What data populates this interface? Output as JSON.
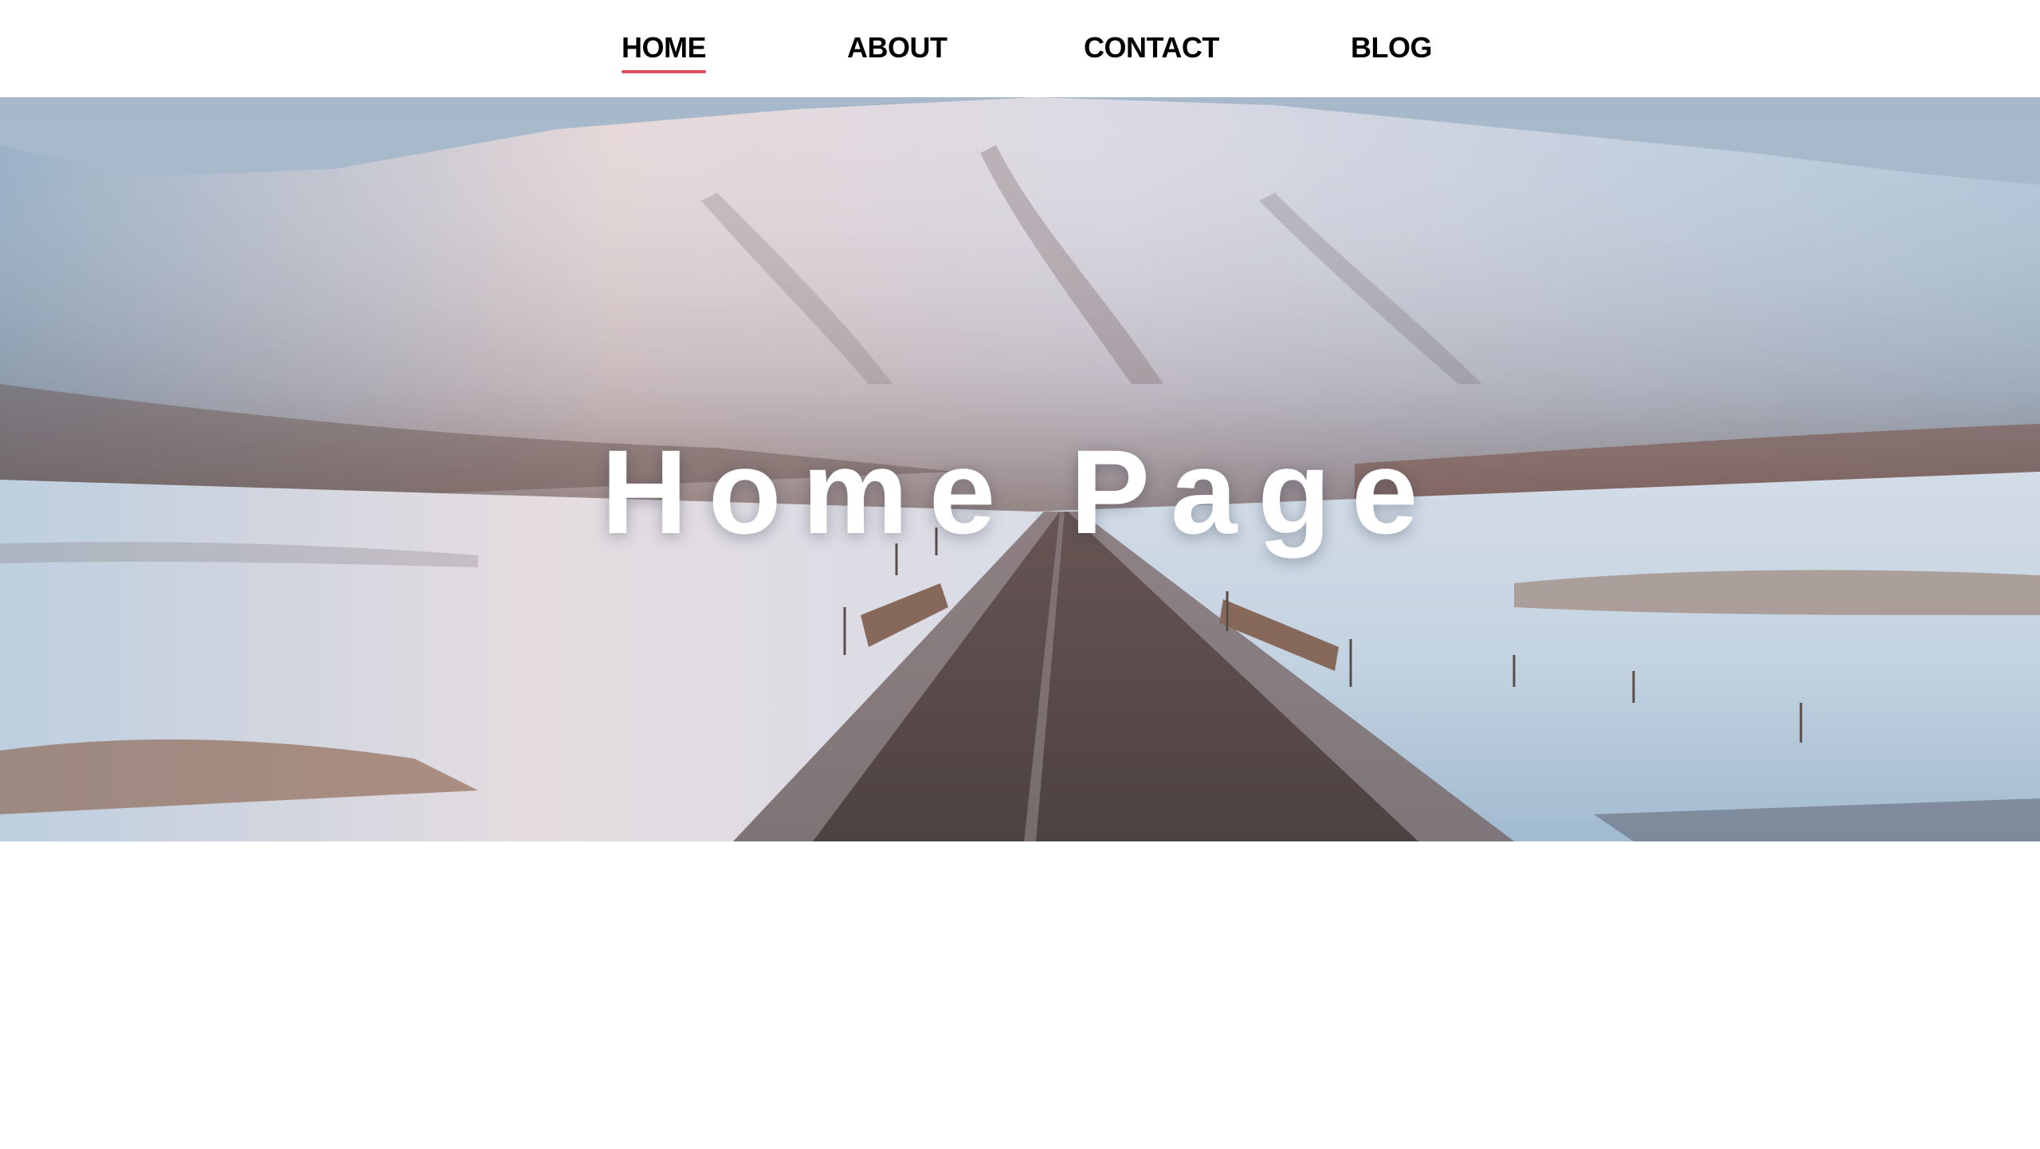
{
  "nav": {
    "items": [
      {
        "label": "HOME",
        "active": true
      },
      {
        "label": "ABOUT",
        "active": false
      },
      {
        "label": "CONTACT",
        "active": false
      },
      {
        "label": "BLOG",
        "active": false
      }
    ],
    "active_underline_color": "#e0505a"
  },
  "hero": {
    "title": "Home Page",
    "image": "snowy-mountain-road-photo"
  }
}
